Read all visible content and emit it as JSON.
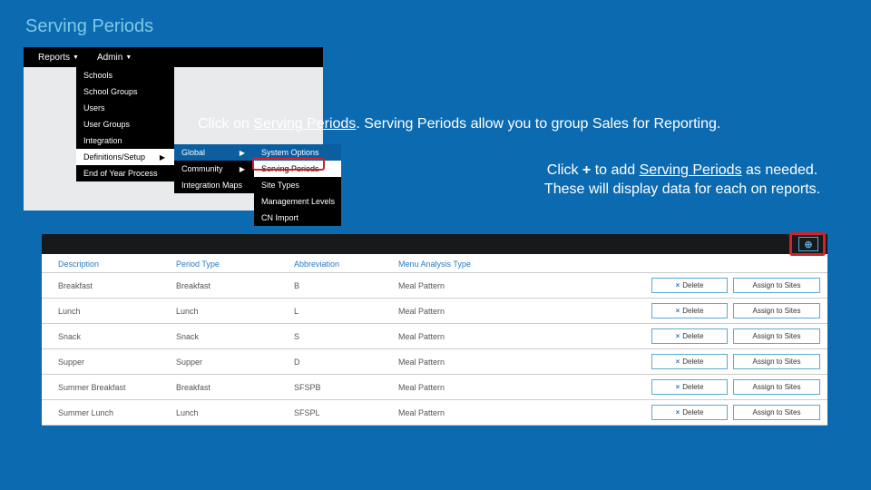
{
  "title": "Serving Periods",
  "menubar": {
    "reports": "Reports",
    "admin": "Admin"
  },
  "dd1": {
    "schools": "Schools",
    "schoolGroups": "School Groups",
    "users": "Users",
    "userGroups": "User Groups",
    "integration": "Integration",
    "definitions": "Definitions/Setup",
    "eoy": "End of Year Process"
  },
  "dd2": {
    "global": "Global",
    "community": "Community",
    "integrationMaps": "Integration Maps"
  },
  "dd3": {
    "systemOptions": "System Options",
    "servingPeriods": "Serving Periods",
    "siteTypes": "Site Types",
    "managementLevels": "Management Levels",
    "cnImport": "CN Import"
  },
  "instr1_a": "Click on ",
  "instr1_link": "Serving Periods",
  "instr1_b": ".  Serving Periods allow you to group Sales for Reporting.",
  "instr2_a": "Click ",
  "instr2_plus": "+",
  "instr2_b": " to add ",
  "instr2_link": "Serving Periods",
  "instr2_c": " as needed. These will display data for each on reports.",
  "plus_glyph": "⊕",
  "headers": {
    "description": "Description",
    "periodType": "Period Type",
    "abbreviation": "Abbreviation",
    "menuAnalysisType": "Menu Analysis Type"
  },
  "buttons": {
    "delete": "Delete",
    "assign": "Assign to Sites"
  },
  "rows": [
    {
      "desc": "Breakfast",
      "ptype": "Breakfast",
      "abbr": "B",
      "menu": "Meal Pattern"
    },
    {
      "desc": "Lunch",
      "ptype": "Lunch",
      "abbr": "L",
      "menu": "Meal Pattern"
    },
    {
      "desc": "Snack",
      "ptype": "Snack",
      "abbr": "S",
      "menu": "Meal Pattern"
    },
    {
      "desc": "Supper",
      "ptype": "Supper",
      "abbr": "D",
      "menu": "Meal Pattern"
    },
    {
      "desc": "Summer Breakfast",
      "ptype": "Breakfast",
      "abbr": "SFSPB",
      "menu": "Meal Pattern"
    },
    {
      "desc": "Summer Lunch",
      "ptype": "Lunch",
      "abbr": "SFSPL",
      "menu": "Meal Pattern"
    }
  ]
}
